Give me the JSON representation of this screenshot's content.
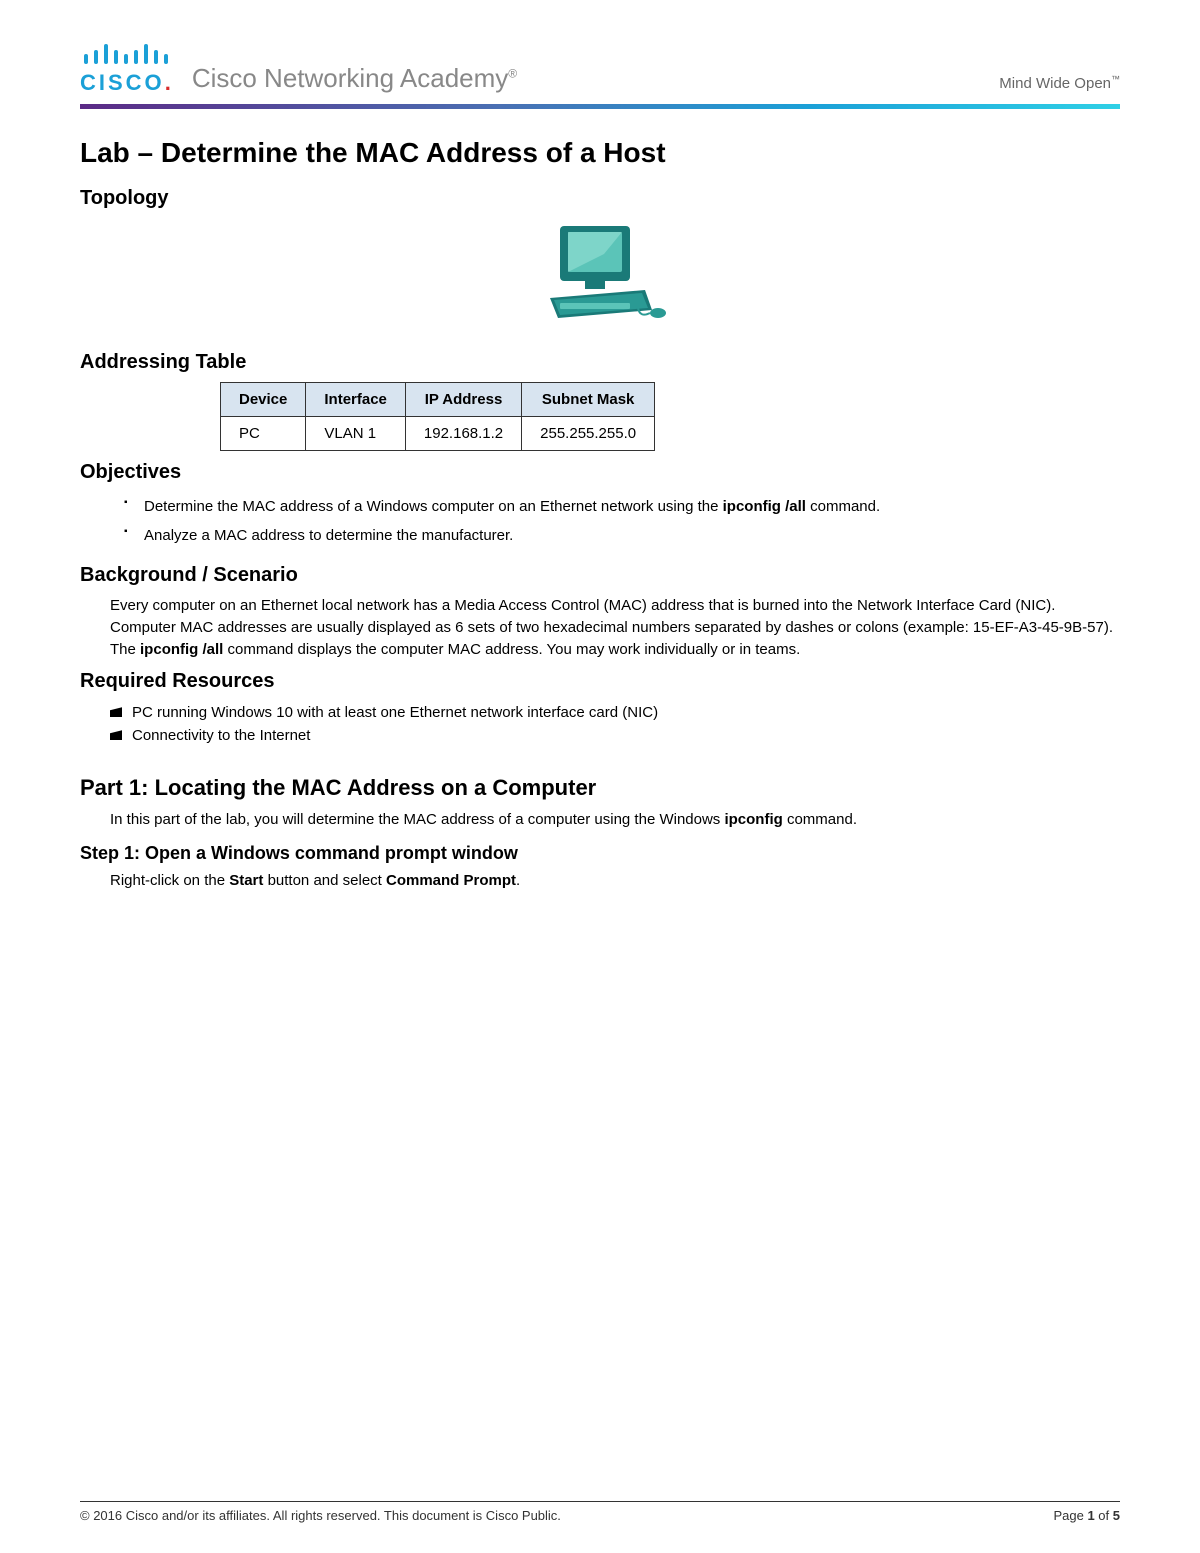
{
  "header": {
    "brand_word": "CISCO",
    "academy": "Cisco Networking Academy",
    "tagline": "Mind Wide Open"
  },
  "title": "Lab – Determine the MAC Address of a Host",
  "sections": {
    "topology_heading": "Topology",
    "addressing_heading": "Addressing Table",
    "objectives_heading": "Objectives",
    "background_heading": "Background / Scenario",
    "resources_heading": "Required Resources",
    "part1_heading": "Part 1: Locating the MAC Address on a Computer",
    "step1_heading": "Step 1: Open a Windows command prompt window"
  },
  "addressing_table": {
    "headers": [
      "Device",
      "Interface",
      "IP Address",
      "Subnet Mask"
    ],
    "row": {
      "device": "PC",
      "interface": "VLAN 1",
      "ip": "192.168.1.2",
      "mask": "255.255.255.0"
    }
  },
  "objectives": {
    "item1_pre": "Determine the MAC address of a Windows computer on an Ethernet network using the ",
    "item1_bold": "ipconfig /all",
    "item1_post": " command.",
    "item2": "Analyze a MAC address to determine the manufacturer."
  },
  "background": {
    "p_pre": "Every computer on an Ethernet local network has a Media Access Control (MAC) address that is burned into the Network Interface Card (NIC). Computer MAC addresses are usually displayed as 6 sets of two hexadecimal numbers separated by dashes or colons (example: 15-EF-A3-45-9B-57). The ",
    "p_bold": "ipconfig /all",
    "p_post": " command displays the computer MAC address. You may work individually or in teams."
  },
  "resources": {
    "r1": "PC running Windows 10 with at least one Ethernet network interface card (NIC)",
    "r2": "Connectivity to the Internet"
  },
  "part1": {
    "intro_pre": "In this part of the lab, you will determine the MAC address of a computer using the Windows ",
    "intro_bold": "ipconfig",
    "intro_post": " command.",
    "step1_pre": "Right-click on the ",
    "step1_b1": "Start",
    "step1_mid": " button and select ",
    "step1_b2": "Command Prompt",
    "step1_post": "."
  },
  "footer": {
    "copyright": "© 2016 Cisco and/or its affiliates. All rights reserved. This document is Cisco Public.",
    "page_label": "Page ",
    "page_current": "1",
    "page_of": " of ",
    "page_total": "5"
  }
}
